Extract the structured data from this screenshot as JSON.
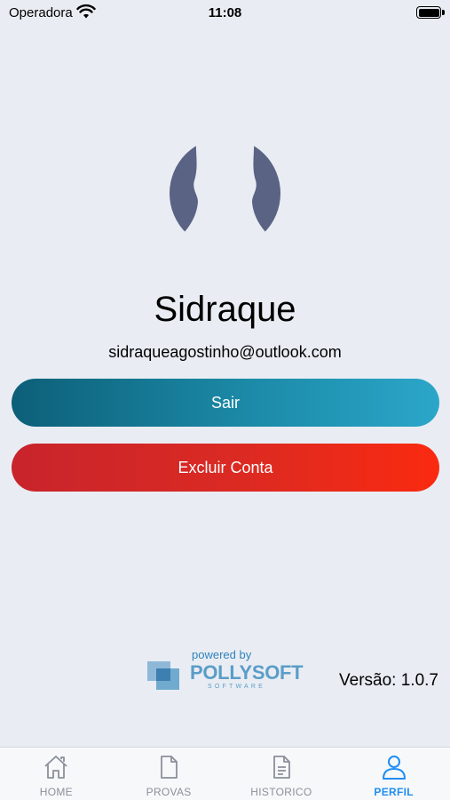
{
  "status_bar": {
    "carrier": "Operadora",
    "time": "11:08",
    "wifi_icon": "wifi-icon",
    "battery_icon": "battery-icon"
  },
  "profile": {
    "avatar_icon": "user-silhouette-icon",
    "name": "Sidraque",
    "email": "sidraqueagostinho@outlook.com"
  },
  "actions": {
    "logout_label": "Sair",
    "delete_account_label": "Excluir Conta"
  },
  "footer": {
    "powered_by": "powered by",
    "brand": "POLLYSOFT",
    "brand_sub": "SOFTWARE",
    "version": "Versão: 1.0.7"
  },
  "tabbar": {
    "items": [
      {
        "label": "HOME",
        "icon": "home-icon",
        "active": false
      },
      {
        "label": "PROVAS",
        "icon": "document-icon",
        "active": false
      },
      {
        "label": "HISTORICO",
        "icon": "document-lines-icon",
        "active": false
      },
      {
        "label": "PERFIL",
        "icon": "person-icon",
        "active": true
      }
    ]
  },
  "colors": {
    "background": "#e9edf3",
    "logout_gradient": [
      "#0d5f78",
      "#2ba6c9"
    ],
    "delete_gradient": [
      "#c8242c",
      "#fa2a10"
    ],
    "active_tab": "#1f8ef1",
    "inactive_tab": "#8a8f99",
    "avatar": "#5a6384"
  }
}
